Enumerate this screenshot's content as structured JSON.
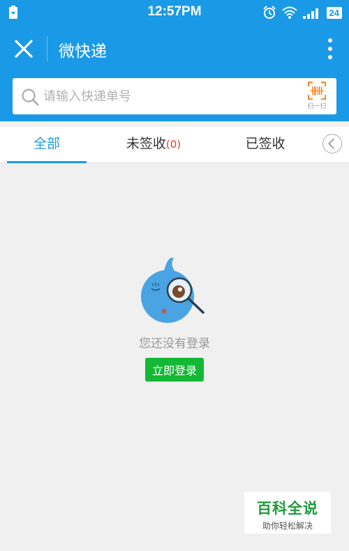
{
  "status_bar": {
    "time": "12:57PM",
    "battery": "24",
    "icons": [
      "sim-card-icon",
      "alarm-icon",
      "wifi-icon",
      "signal-icon",
      "battery-icon"
    ]
  },
  "header": {
    "title": "微快递",
    "close_icon": "close-icon",
    "more_icon": "more-vertical-icon"
  },
  "search": {
    "placeholder": "请输入快递单号",
    "scan_label": "扫一扫"
  },
  "tabs": {
    "all": "全部",
    "unsigned": "未签收",
    "unsigned_count": "(0)",
    "signed": "已签收"
  },
  "empty_state": {
    "message": "您还没有登录",
    "login_button": "立即登录"
  },
  "watermark": {
    "title": "百科全说",
    "subtitle": "助你轻松解决"
  },
  "colors": {
    "primary": "#1a9ae6",
    "login": "#13b834",
    "count": "#e03a3a",
    "watermark": "#1f9a3d"
  }
}
